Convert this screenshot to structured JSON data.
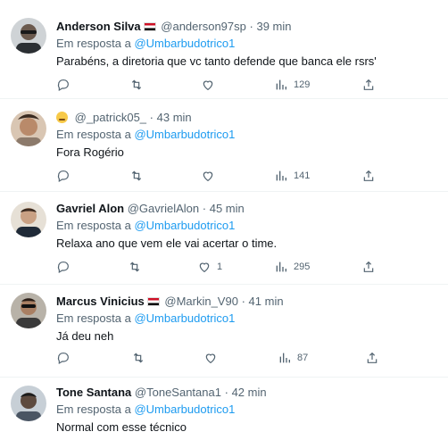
{
  "reply_prefix": "Em resposta a",
  "tweets": [
    {
      "name": "Anderson Silva",
      "handle": "@anderson97sp",
      "sep": "·",
      "time": "39 min",
      "reply_to": "@Umbarbudotrico1",
      "text": "Parabéns, a diretoria que vc tanto defende que banca ele rsrs'",
      "likes": "",
      "views": "129"
    },
    {
      "name": "",
      "handle": "@_patrick05_",
      "sep": "·",
      "time": "43 min",
      "reply_to": "@Umbarbudotrico1",
      "text": "Fora Rogério",
      "likes": "",
      "views": "141"
    },
    {
      "name": "Gavriel Alon",
      "handle": "@GavrielAlon",
      "sep": "·",
      "time": "45 min",
      "reply_to": "@Umbarbudotrico1",
      "text": "Relaxa ano que vem ele vai acertar o time.",
      "likes": "1",
      "views": "295"
    },
    {
      "name": "Marcus Vinicius",
      "handle": "@Markin_V90",
      "sep": "·",
      "time": "41 min",
      "reply_to": "@Umbarbudotrico1",
      "text": "Já deu neh",
      "likes": "",
      "views": "87"
    },
    {
      "name": "Tone Santana",
      "handle": "@ToneSantana1",
      "sep": "·",
      "time": "42 min",
      "reply_to": "@Umbarbudotrico1",
      "text": "Normal com esse técnico",
      "likes": "",
      "views": ""
    }
  ],
  "colors": {
    "mention": "#1d9bf0",
    "secondary": "#536471",
    "divider": "#eff3f4"
  }
}
